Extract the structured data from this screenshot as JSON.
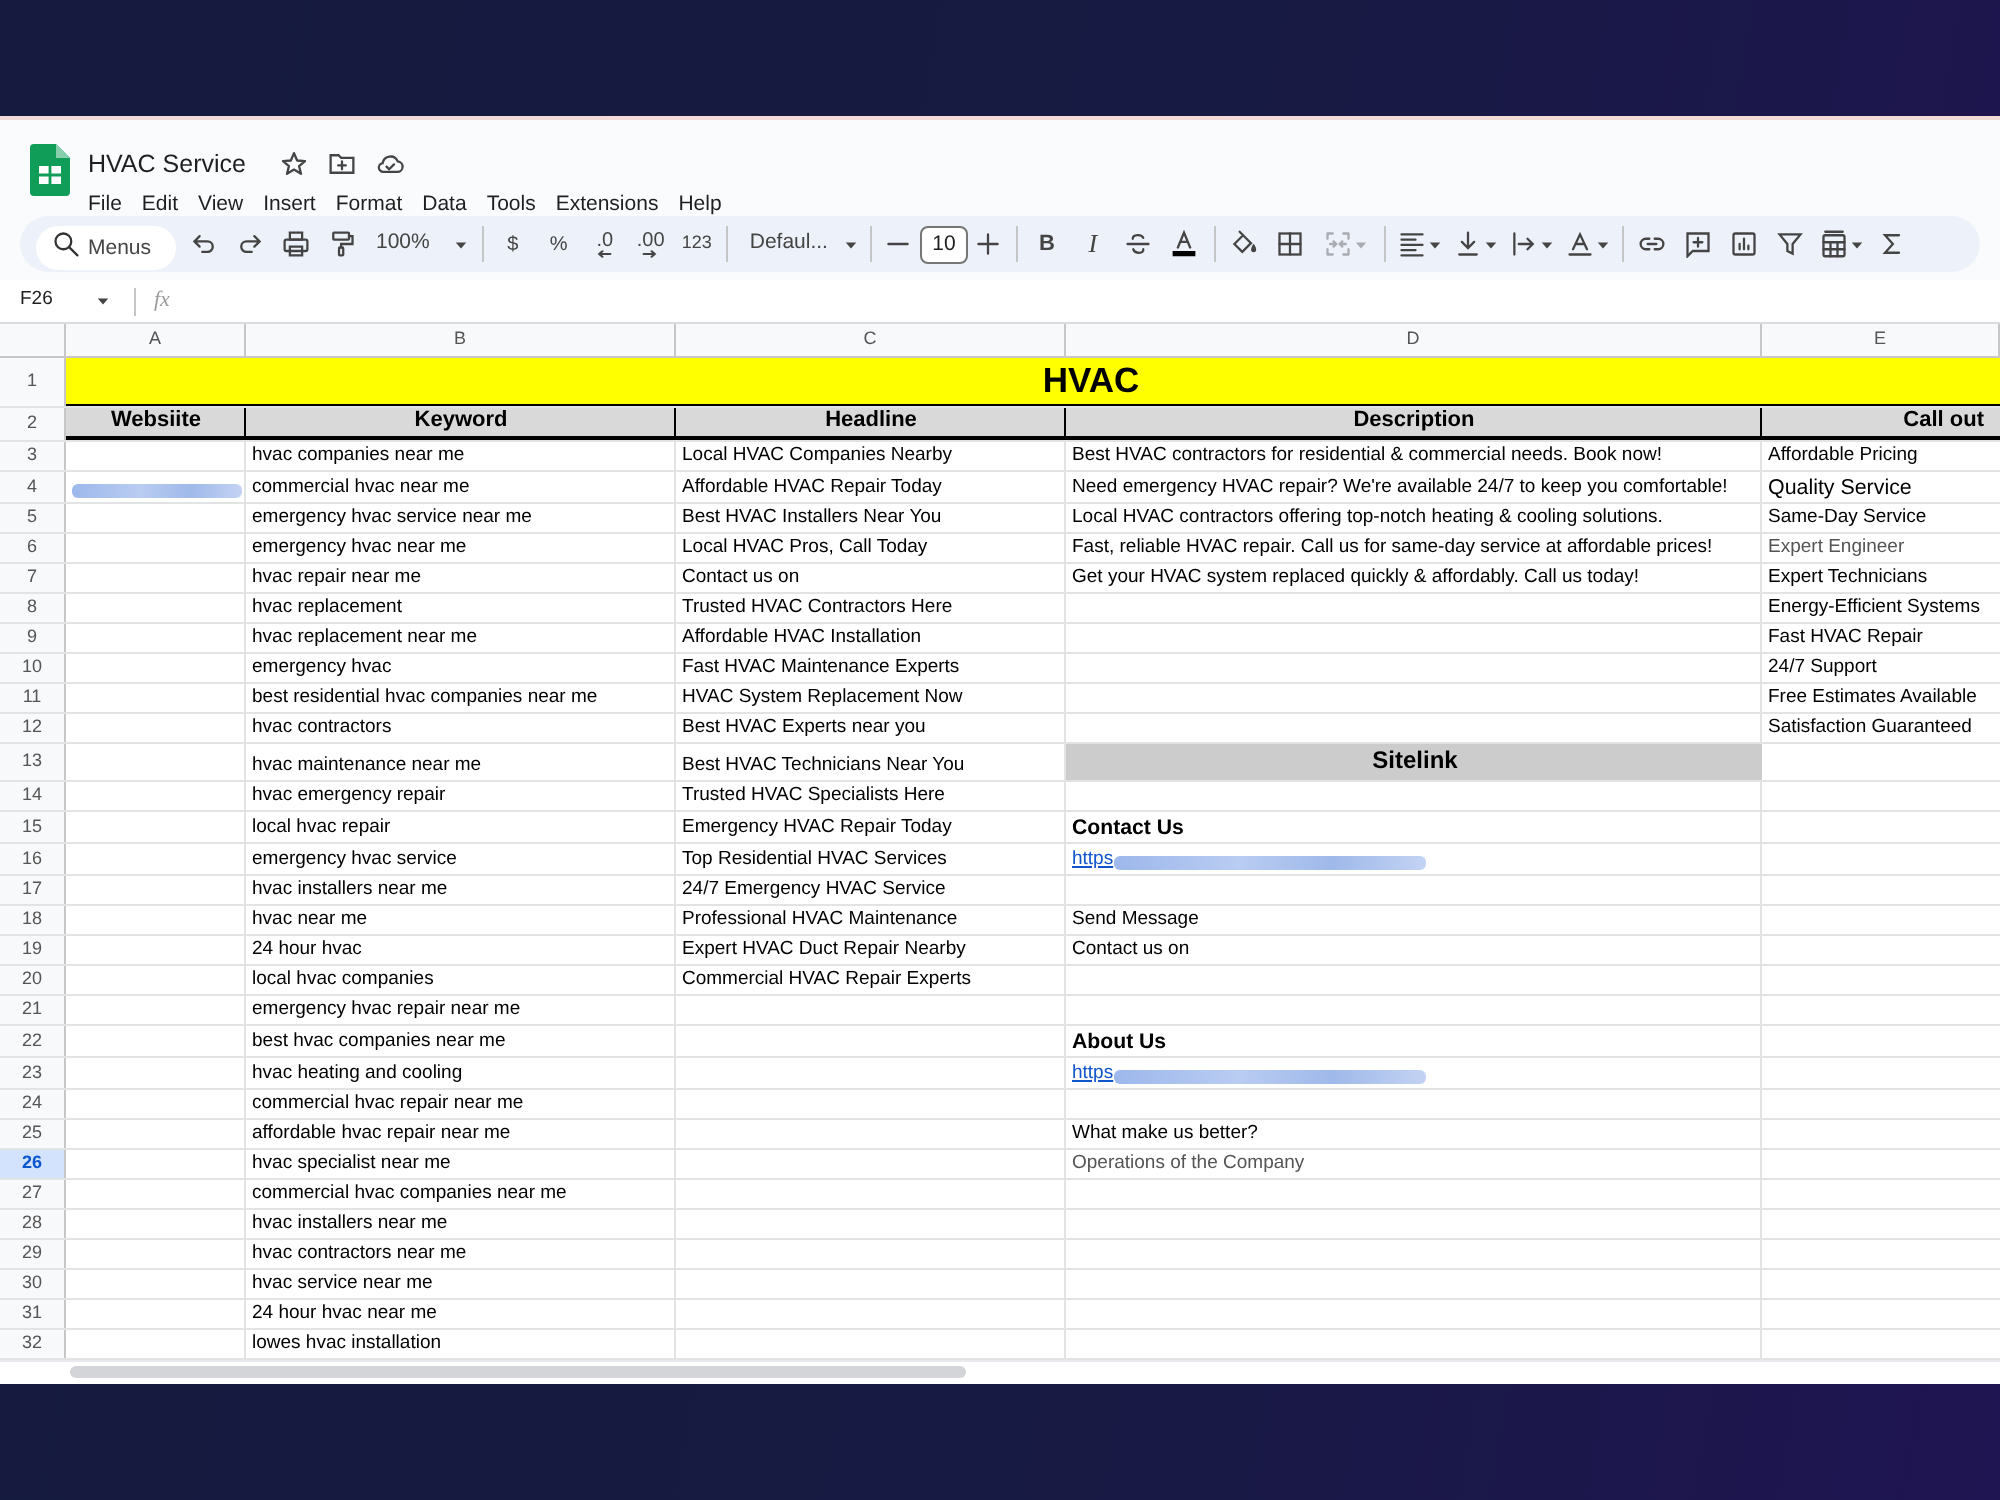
{
  "window": {
    "title": "HVAC Service"
  },
  "menu": [
    "File",
    "Edit",
    "View",
    "Insert",
    "Format",
    "Data",
    "Tools",
    "Extensions",
    "Help"
  ],
  "toolbar": {
    "search": {
      "placeholder": "Menus"
    },
    "zoom": "100%",
    "number_formats": [
      {
        "kind": "currency",
        "label": "$"
      },
      {
        "kind": "percent",
        "label": "%"
      },
      {
        "kind": "decrease_decimal",
        "label": ".0"
      },
      {
        "kind": "increase_decimal",
        "label": ".00"
      },
      {
        "kind": "more_formats",
        "label": "123"
      }
    ],
    "font": "Defaul...",
    "font_size": "10",
    "text_styles": [
      {
        "kind": "bold",
        "label": "B"
      },
      {
        "kind": "italic",
        "label": "I"
      }
    ],
    "merge_cells": {
      "disabled": true
    }
  },
  "formula_bar": {
    "name_box": "F26",
    "fx": "fx"
  },
  "sheet": {
    "columns": [
      "A",
      "B",
      "C",
      "D",
      "E"
    ],
    "rows": [
      {
        "number": "1",
        "selected": false,
        "cells": {
          "A": {
            "kind": "title",
            "text": "HVAC"
          }
        }
      },
      {
        "number": "2",
        "selected": false,
        "cells": {
          "A": {
            "kind": "header",
            "text": "Websiite"
          },
          "B": {
            "kind": "header",
            "text": "Keyword"
          },
          "C": {
            "kind": "header",
            "text": "Headline"
          },
          "D": {
            "kind": "header",
            "text": "Description"
          },
          "E": {
            "kind": "header",
            "text": "Call out"
          }
        }
      },
      {
        "number": "3",
        "selected": false,
        "cells": {
          "B": {
            "kind": "text",
            "text": "hvac companies near me"
          },
          "C": {
            "kind": "text",
            "text": "Local HVAC Companies Nearby"
          },
          "D": {
            "kind": "text",
            "text": "Best HVAC contractors for residential & commercial needs. Book now!"
          },
          "E": {
            "kind": "text",
            "text": "Affordable Pricing"
          }
        }
      },
      {
        "number": "4",
        "selected": false,
        "cells": {
          "A": {
            "kind": "link"
          },
          "B": {
            "kind": "text",
            "text": "commercial hvac near me"
          },
          "C": {
            "kind": "text",
            "text": "Affordable HVAC Repair Today"
          },
          "D": {
            "kind": "text",
            "text": "Need emergency HVAC repair? We're available 24/7 to keep you comfortable!"
          },
          "E": {
            "kind": "large",
            "text": "Quality Service"
          }
        }
      },
      {
        "number": "5",
        "selected": false,
        "cells": {
          "B": {
            "kind": "text",
            "text": "emergency hvac service near me"
          },
          "C": {
            "kind": "text",
            "text": "Best HVAC Installers Near You"
          },
          "D": {
            "kind": "text",
            "text": "Local HVAC contractors offering top-notch heating & cooling solutions."
          },
          "E": {
            "kind": "text",
            "text": "Same-Day Service"
          }
        }
      },
      {
        "number": "6",
        "selected": false,
        "cells": {
          "B": {
            "kind": "text",
            "text": "emergency hvac near me"
          },
          "C": {
            "kind": "text",
            "text": "Local HVAC Pros, Call Today"
          },
          "D": {
            "kind": "text",
            "text": "Fast, reliable HVAC repair. Call us for same-day service at affordable prices!"
          },
          "E": {
            "kind": "muted",
            "text": "Expert Engineer"
          }
        }
      },
      {
        "number": "7",
        "selected": false,
        "cells": {
          "B": {
            "kind": "text",
            "text": "hvac repair near me"
          },
          "C": {
            "kind": "text",
            "text": "Contact us on"
          },
          "D": {
            "kind": "text",
            "text": "Get your HVAC system replaced quickly & affordably. Call us today!"
          },
          "E": {
            "kind": "text",
            "text": "Expert Technicians"
          }
        }
      },
      {
        "number": "8",
        "selected": false,
        "cells": {
          "B": {
            "kind": "text",
            "text": "hvac replacement"
          },
          "C": {
            "kind": "text",
            "text": "Trusted HVAC Contractors Here"
          },
          "E": {
            "kind": "text",
            "text": "Energy-Efficient Systems"
          }
        }
      },
      {
        "number": "9",
        "selected": false,
        "cells": {
          "B": {
            "kind": "text",
            "text": "hvac replacement near me"
          },
          "C": {
            "kind": "text",
            "text": "Affordable HVAC Installation"
          },
          "E": {
            "kind": "text",
            "text": "Fast HVAC Repair"
          }
        }
      },
      {
        "number": "10",
        "selected": false,
        "cells": {
          "B": {
            "kind": "text",
            "text": "emergency hvac"
          },
          "C": {
            "kind": "text",
            "text": "Fast HVAC Maintenance Experts"
          },
          "E": {
            "kind": "text",
            "text": "24/7 Support"
          }
        }
      },
      {
        "number": "11",
        "selected": false,
        "cells": {
          "B": {
            "kind": "text",
            "text": "best residential hvac companies near me"
          },
          "C": {
            "kind": "text",
            "text": "HVAC System Replacement Now"
          },
          "E": {
            "kind": "text",
            "text": "Free Estimates Available"
          }
        }
      },
      {
        "number": "12",
        "selected": false,
        "cells": {
          "B": {
            "kind": "text",
            "text": "hvac contractors"
          },
          "C": {
            "kind": "text",
            "text": "Best HVAC Experts near you"
          },
          "E": {
            "kind": "text",
            "text": "Satisfaction Guaranteed"
          }
        }
      },
      {
        "number": "13",
        "selected": false,
        "cells": {
          "B": {
            "kind": "text",
            "text": "hvac maintenance near me"
          },
          "C": {
            "kind": "text",
            "text": "Best HVAC Technicians Near You"
          },
          "D": {
            "kind": "section",
            "text": "Sitelink"
          }
        }
      },
      {
        "number": "14",
        "selected": false,
        "cells": {
          "B": {
            "kind": "text",
            "text": "hvac emergency repair"
          },
          "C": {
            "kind": "text",
            "text": "Trusted HVAC Specialists Here"
          }
        }
      },
      {
        "number": "15",
        "selected": false,
        "cells": {
          "B": {
            "kind": "text",
            "text": "local hvac repair"
          },
          "C": {
            "kind": "text",
            "text": "Emergency HVAC Repair Today"
          },
          "D": {
            "kind": "bold",
            "text": "Contact Us"
          }
        }
      },
      {
        "number": "16",
        "selected": false,
        "cells": {
          "B": {
            "kind": "text",
            "text": "emergency hvac service"
          },
          "C": {
            "kind": "text",
            "text": "Top Residential HVAC Services"
          },
          "D": {
            "kind": "link",
            "text": "https"
          }
        }
      },
      {
        "number": "17",
        "selected": false,
        "cells": {
          "B": {
            "kind": "text",
            "text": "hvac installers near me"
          },
          "C": {
            "kind": "text",
            "text": "24/7 Emergency HVAC Service"
          }
        }
      },
      {
        "number": "18",
        "selected": false,
        "cells": {
          "B": {
            "kind": "text",
            "text": "hvac near me"
          },
          "C": {
            "kind": "text",
            "text": "Professional HVAC Maintenance"
          },
          "D": {
            "kind": "text",
            "text": "Send Message"
          }
        }
      },
      {
        "number": "19",
        "selected": false,
        "cells": {
          "B": {
            "kind": "text",
            "text": "24 hour hvac"
          },
          "C": {
            "kind": "text",
            "text": "Expert HVAC Duct Repair Nearby"
          },
          "D": {
            "kind": "text",
            "text": "Contact us on"
          }
        }
      },
      {
        "number": "20",
        "selected": false,
        "cells": {
          "B": {
            "kind": "text",
            "text": "local hvac companies"
          },
          "C": {
            "kind": "text",
            "text": "Commercial HVAC Repair Experts"
          }
        }
      },
      {
        "number": "21",
        "selected": false,
        "cells": {
          "B": {
            "kind": "text",
            "text": "emergency hvac repair near me"
          }
        }
      },
      {
        "number": "22",
        "selected": false,
        "cells": {
          "B": {
            "kind": "text",
            "text": "best hvac companies near me"
          },
          "D": {
            "kind": "bold",
            "text": "About Us"
          }
        }
      },
      {
        "number": "23",
        "selected": false,
        "cells": {
          "B": {
            "kind": "text",
            "text": "hvac heating and cooling"
          },
          "D": {
            "kind": "link",
            "text": "https"
          }
        }
      },
      {
        "number": "24",
        "selected": false,
        "cells": {
          "B": {
            "kind": "text",
            "text": "commercial hvac repair near me"
          }
        }
      },
      {
        "number": "25",
        "selected": false,
        "cells": {
          "B": {
            "kind": "text",
            "text": "affordable hvac repair near me"
          },
          "D": {
            "kind": "text",
            "text": "What make us better?"
          }
        }
      },
      {
        "number": "26",
        "selected": true,
        "cells": {
          "B": {
            "kind": "text",
            "text": "hvac specialist near me"
          },
          "D": {
            "kind": "muted",
            "text": "Operations of the Company"
          }
        }
      },
      {
        "number": "27",
        "selected": false,
        "cells": {
          "B": {
            "kind": "text",
            "text": "commercial hvac companies near me"
          }
        }
      },
      {
        "number": "28",
        "selected": false,
        "cells": {
          "B": {
            "kind": "text",
            "text": "hvac installers near me"
          }
        }
      },
      {
        "number": "29",
        "selected": false,
        "cells": {
          "B": {
            "kind": "text",
            "text": "hvac contractors near me"
          }
        }
      },
      {
        "number": "30",
        "selected": false,
        "cells": {
          "B": {
            "kind": "text",
            "text": "hvac service near me"
          }
        }
      },
      {
        "number": "31",
        "selected": false,
        "cells": {
          "B": {
            "kind": "text",
            "text": "24 hour hvac near me"
          }
        }
      },
      {
        "number": "32",
        "selected": false,
        "cells": {
          "B": {
            "kind": "text",
            "text": "lowes hvac installation"
          }
        }
      }
    ]
  }
}
